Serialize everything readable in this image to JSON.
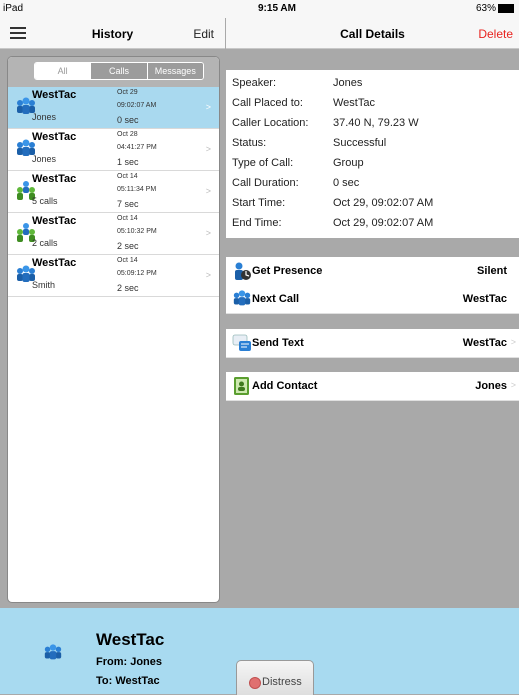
{
  "status_bar": {
    "device": "iPad",
    "time": "9:15 AM",
    "battery": "63%"
  },
  "history": {
    "title": "History",
    "edit_label": "Edit",
    "filters": [
      "All",
      "Calls",
      "Messages"
    ],
    "selected_filter": "All",
    "items": [
      {
        "name": "WestTac",
        "sub": "Jones",
        "date": "Oct 29",
        "time": "09:02:07 AM",
        "duration": "0 sec",
        "selected": true,
        "icon": "group-icon"
      },
      {
        "name": "WestTac",
        "sub": "Jones",
        "date": "Oct 28",
        "time": "04:41:27 PM",
        "duration": "1 sec",
        "selected": false,
        "icon": "group-icon"
      },
      {
        "name": "WestTac",
        "sub": "5 calls",
        "date": "Oct 14",
        "time": "05:11:34 PM",
        "duration": "7 sec",
        "selected": false,
        "icon": "multi-group-icon"
      },
      {
        "name": "WestTac",
        "sub": "2 calls",
        "date": "Oct 14",
        "time": "05:10:32 PM",
        "duration": "2 sec",
        "selected": false,
        "icon": "multi-group-icon"
      },
      {
        "name": "WestTac",
        "sub": "Smith",
        "date": "Oct 14",
        "time": "05:09:12 PM",
        "duration": "2 sec",
        "selected": false,
        "icon": "group-icon"
      }
    ]
  },
  "call_details": {
    "title": "Call Details",
    "delete_label": "Delete",
    "fields": [
      {
        "label": "Speaker:",
        "value": "Jones"
      },
      {
        "label": "Call Placed to:",
        "value": "WestTac"
      },
      {
        "label": "Caller Location:",
        "value": "37.40 N, 79.23 W"
      },
      {
        "label": "Status:",
        "value": "Successful"
      },
      {
        "label": "Type of Call:",
        "value": "Group"
      },
      {
        "label": "Call Duration:",
        "value": "0 sec"
      },
      {
        "label": "Start Time:",
        "value": "Oct 29, 09:02:07 AM"
      },
      {
        "label": "End Time:",
        "value": "Oct 29, 09:02:07 AM"
      }
    ],
    "actions": [
      {
        "label": "Get Presence",
        "value": "Silent",
        "icon": "presence-icon"
      },
      {
        "label": "Next Call",
        "value": "WestTac",
        "icon": "group-icon"
      },
      {
        "label": "Send Text",
        "value": "WestTac",
        "icon": "message-icon"
      },
      {
        "label": "Add Contact",
        "value": "Jones",
        "icon": "contact-book-icon"
      }
    ]
  },
  "bottom_bar": {
    "name": "WestTac",
    "from": "From: Jones",
    "to": "To: WestTac",
    "distress_label": "Distress"
  },
  "colors": {
    "selection": "#a9d9ef",
    "delete": "#e8231f",
    "bottom_bar": "#a8daf0"
  }
}
